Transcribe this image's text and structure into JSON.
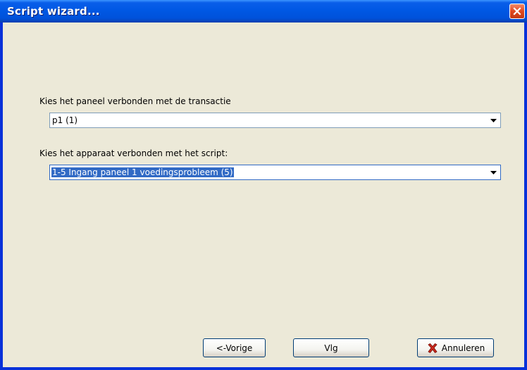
{
  "window": {
    "title": "Script wizard..."
  },
  "form": {
    "panel_label": "Kies het paneel verbonden met de transactie",
    "panel_value": "p1  (1)",
    "device_label": "Kies het apparaat verbonden met het script:",
    "device_value": "1-5 Ingang paneel 1 voedingsprobleem  (5)"
  },
  "buttons": {
    "previous": "<-Vorige",
    "next": "Vlg",
    "cancel": "Annuleren"
  },
  "icons": {
    "close": "close-icon",
    "dropdown": "chevron-down-icon",
    "cancel": "red-x-icon"
  },
  "colors": {
    "titlebar": "#0058e4",
    "selection": "#316ac5",
    "close": "#e0481f",
    "cancel_icon": "#c8261b"
  }
}
